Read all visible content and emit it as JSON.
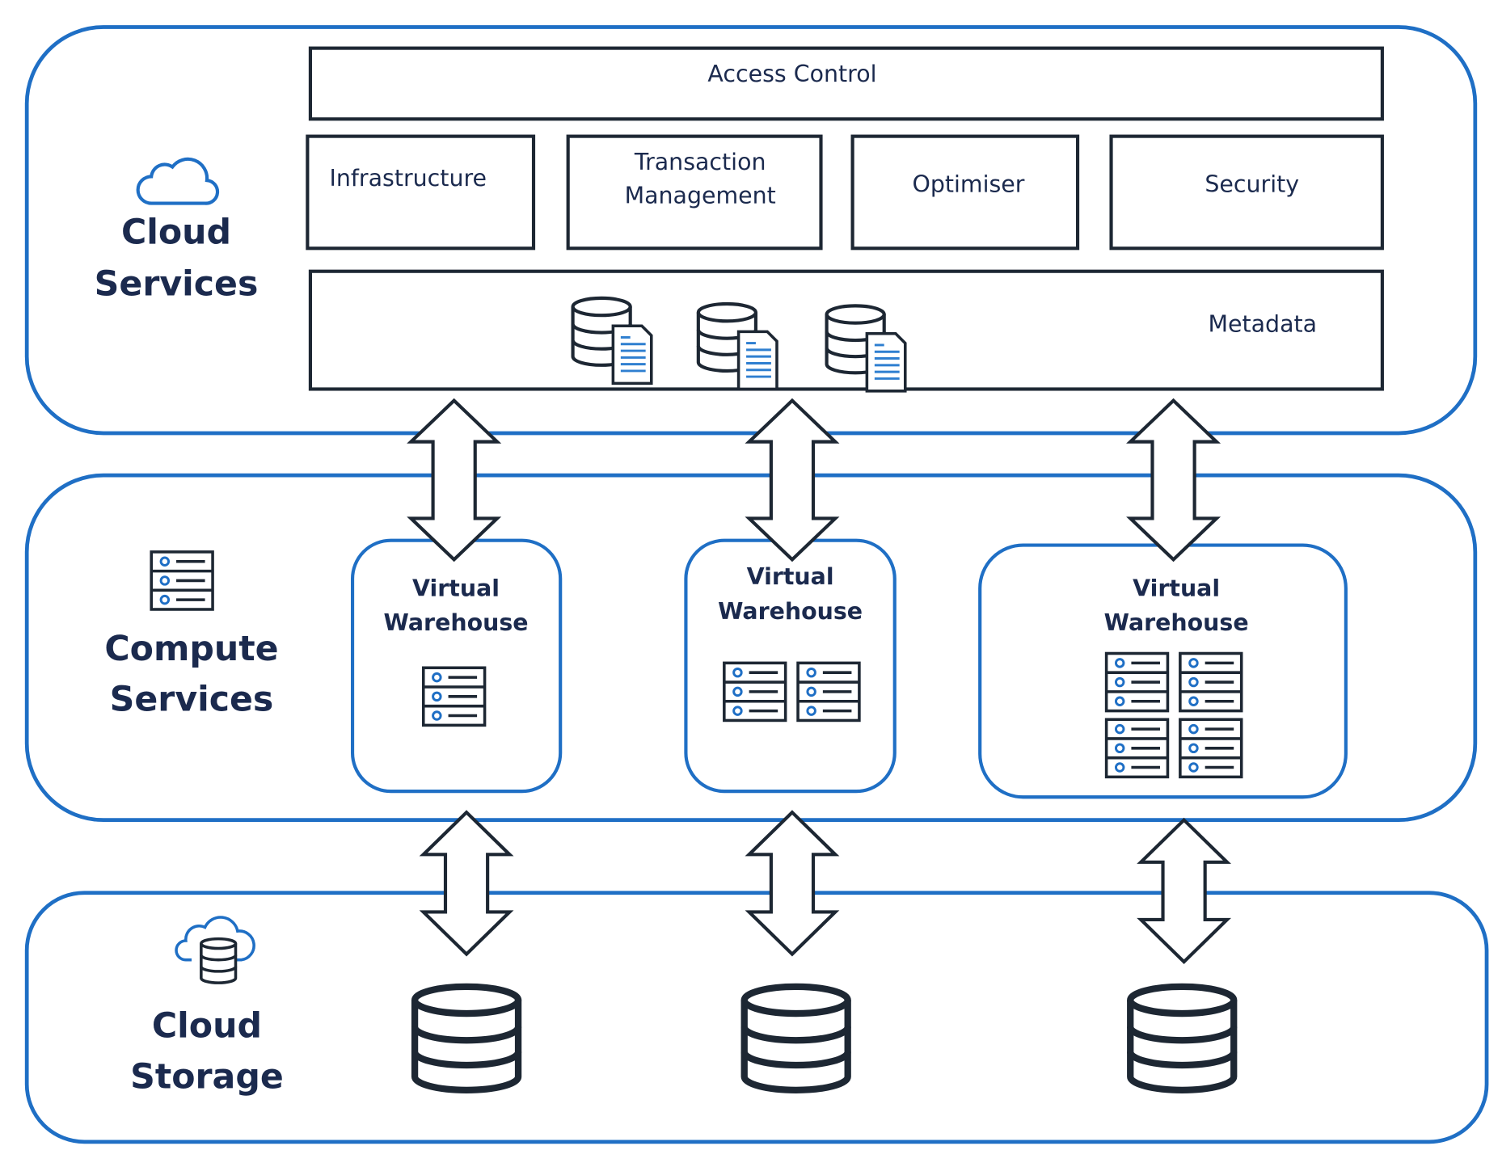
{
  "colors": {
    "accent": "#1f6fc5",
    "ink": "#1b2a4e",
    "stroke": "#1d2733"
  },
  "layers": {
    "cloud_services": {
      "title_line1": "Cloud",
      "title_line2": "Services",
      "icon": "cloud-icon",
      "access_control": "Access Control",
      "modules": [
        "Infrastructure",
        "Transaction",
        "Management",
        "Optimiser",
        "Security"
      ],
      "metadata": "Metadata",
      "metadata_icon": "database-document-icon"
    },
    "compute_services": {
      "title_line1": "Compute",
      "title_line2": "Services",
      "icon": "server-icon",
      "warehouses": [
        {
          "line1": "Virtual",
          "line2": "Warehouse",
          "servers": 1
        },
        {
          "line1": "Virtual",
          "line2": "Warehouse",
          "servers": 2
        },
        {
          "line1": "Virtual",
          "line2": "Warehouse",
          "servers": 4
        }
      ]
    },
    "cloud_storage": {
      "title_line1": "Cloud",
      "title_line2": "Storage",
      "icon": "cloud-database-icon",
      "databases": 3
    }
  }
}
